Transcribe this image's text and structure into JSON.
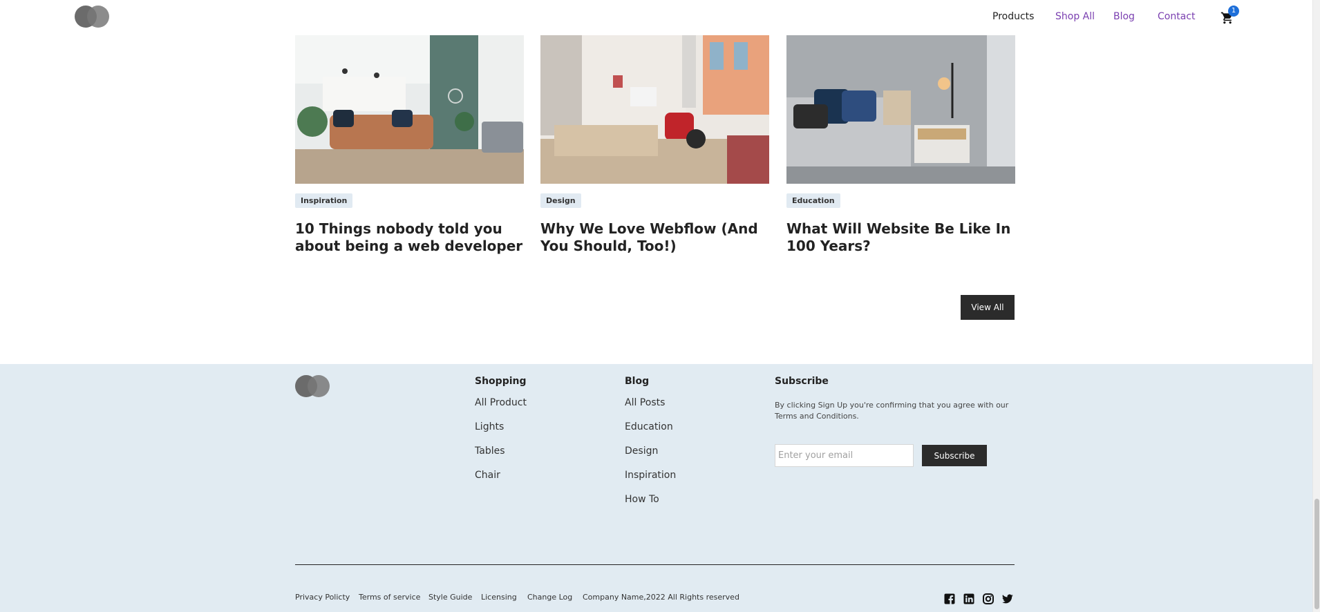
{
  "header": {
    "nav": {
      "products": "Products",
      "shop_all": "Shop All",
      "blog": "Blog",
      "contact": "Contact"
    },
    "cart_count": "1",
    "cart_icon": "shopping-cart-icon",
    "colors": {
      "nav_link": "#7a3fb0",
      "badge": "#1e6fd9"
    }
  },
  "blog_cards": [
    {
      "tag": "Inspiration",
      "title": "10 Things nobody told you about being a web developer",
      "image": "living-room-photo"
    },
    {
      "tag": "Design",
      "title": "Why We Love Webflow (And You Should, Too!)",
      "image": "dining-area-photo"
    },
    {
      "tag": "Education",
      "title": "What Will Website Be Like In 100 Years?",
      "image": "bedroom-photo"
    }
  ],
  "view_all_label": "View All",
  "footer": {
    "shopping": {
      "heading": "Shopping",
      "items": [
        "All Product",
        "Lights",
        "Tables",
        "Chair"
      ]
    },
    "blog": {
      "heading": "Blog",
      "items": [
        "All Posts",
        "Education",
        "Design",
        "Inspiration",
        "How To"
      ]
    },
    "subscribe": {
      "heading": "Subscribe",
      "text": "By clicking Sign Up you're confirming that you agree with our Terms and Conditions.",
      "placeholder": "Enter your email",
      "button": "Subscribe"
    },
    "legal": {
      "privacy": "Privacy Policty",
      "terms": "Terms of service",
      "style_guide": "Style Guide",
      "licensing": "Licensing",
      "change_log": "Change Log",
      "copyright": "Company Name,2022 All Rights reserved"
    },
    "social_icons": [
      "facebook-icon",
      "linkedin-icon",
      "instagram-icon",
      "twitter-icon"
    ],
    "background": "#e1ebf2"
  }
}
